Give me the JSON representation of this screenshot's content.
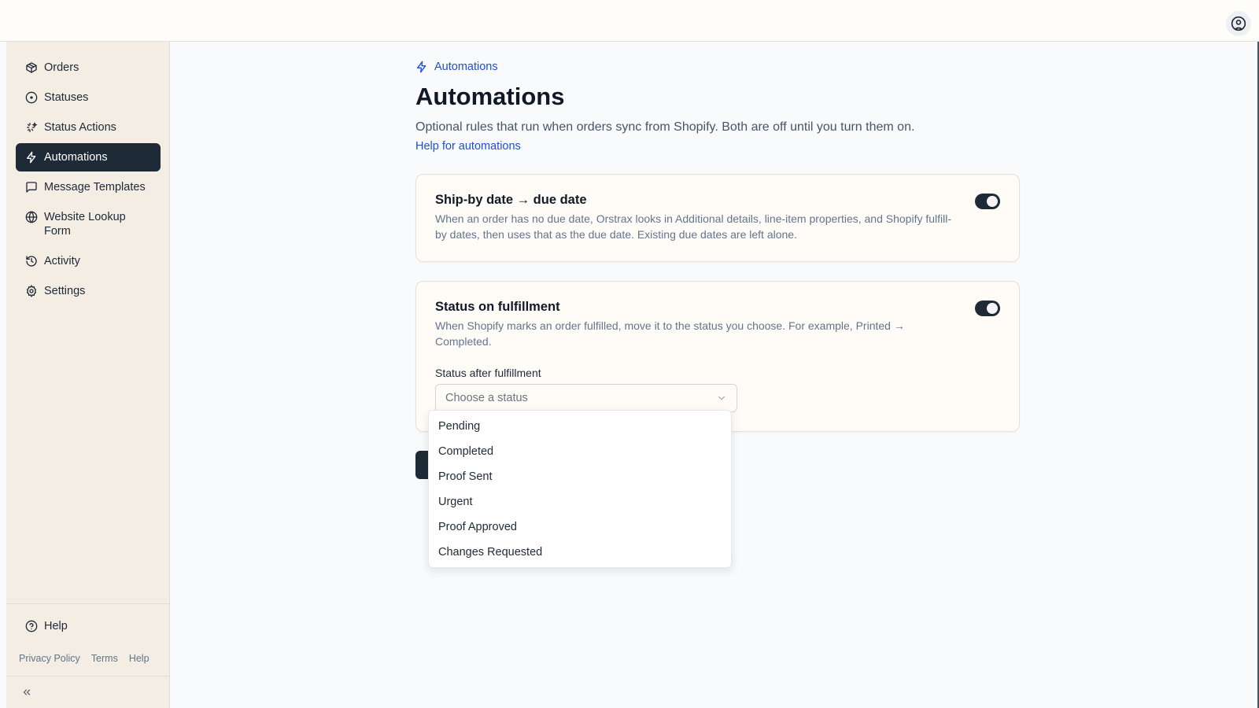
{
  "sidebar": {
    "items": [
      {
        "label": "Orders",
        "icon": "package-icon"
      },
      {
        "label": "Statuses",
        "icon": "circle-dot-icon"
      },
      {
        "label": "Status Actions",
        "icon": "sparkle-icon"
      },
      {
        "label": "Automations",
        "icon": "lightning-icon",
        "active": true
      },
      {
        "label": "Message Templates",
        "icon": "message-square-icon"
      },
      {
        "label": "Website Lookup Form",
        "icon": "globe-icon"
      },
      {
        "label": "Activity",
        "icon": "history-icon"
      },
      {
        "label": "Settings",
        "icon": "gear-icon"
      }
    ],
    "help_label": "Help",
    "footer_links": [
      "Privacy Policy",
      "Terms",
      "Help"
    ]
  },
  "breadcrumb": {
    "label": "Automations"
  },
  "page": {
    "title": "Automations",
    "description": "Optional rules that run when orders sync from Shopify. Both are off until you turn them on.",
    "help_link": "Help for automations"
  },
  "cards": [
    {
      "title": "Ship-by date → due date",
      "description": "When an order has no due date, Orstrax looks in Additional details, line-item properties, and Shopify fulfill-by dates, then uses that as the due date. Existing due dates are left alone.",
      "enabled": true
    },
    {
      "title": "Status on fulfillment",
      "description": "When Shopify marks an order fulfilled, move it to the status you choose. For example, Printed → Completed.",
      "enabled": true,
      "field_label": "Status after fulfillment",
      "select_placeholder": "Choose a status"
    }
  ],
  "dropdown": {
    "options": [
      "Pending",
      "Completed",
      "Proof Sent",
      "Urgent",
      "Proof Approved",
      "Changes Requested"
    ]
  },
  "colors": {
    "primary_dark": "#1f2a37",
    "link": "#1d4ed8",
    "sidebar_bg": "#f3ede4",
    "card_bg": "#fffcf8"
  }
}
